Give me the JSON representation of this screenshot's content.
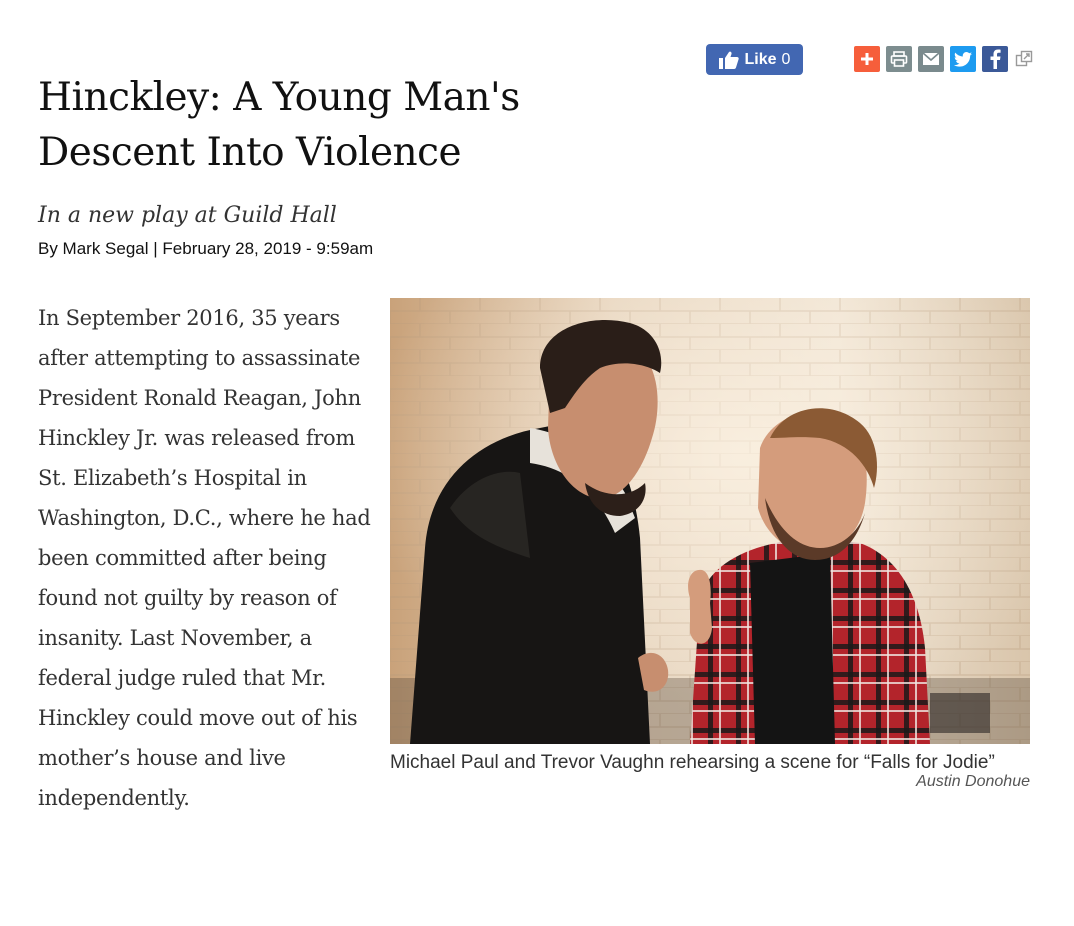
{
  "share": {
    "like_label": "Like",
    "like_count": "0",
    "icons": [
      "plus-icon",
      "print-icon",
      "email-icon",
      "twitter-icon",
      "facebook-icon",
      "external-share-icon"
    ],
    "colors": {
      "facebook_blue": "#4267b2",
      "addthis_orange": "#f65e3b",
      "print_grey": "#7d8d8f",
      "twitter_blue": "#1d9bf0",
      "facebook_share": "#3b5998"
    }
  },
  "article": {
    "title": "Hinckley: A Young Man's Descent Into Violence",
    "subtitle": "In a new play at Guild Hall",
    "byline": "By Mark Segal | February 28, 2019 - 9:59am",
    "body": "In September 2016, 35 years after attempting to assassinate President Ronald Reagan, John Hinckley Jr. was released from St. Elizabeth’s Hospital in Washington, D.C., where he had been committed after being found not guilty by reason of insanity. Last November, a federal judge ruled that Mr. Hinckley could move out of his mother’s house and live independently."
  },
  "photo": {
    "caption": "Michael Paul and Trevor Vaughn rehearsing a scene for “Falls for Jodie”",
    "credit": "Austin Donohue"
  }
}
